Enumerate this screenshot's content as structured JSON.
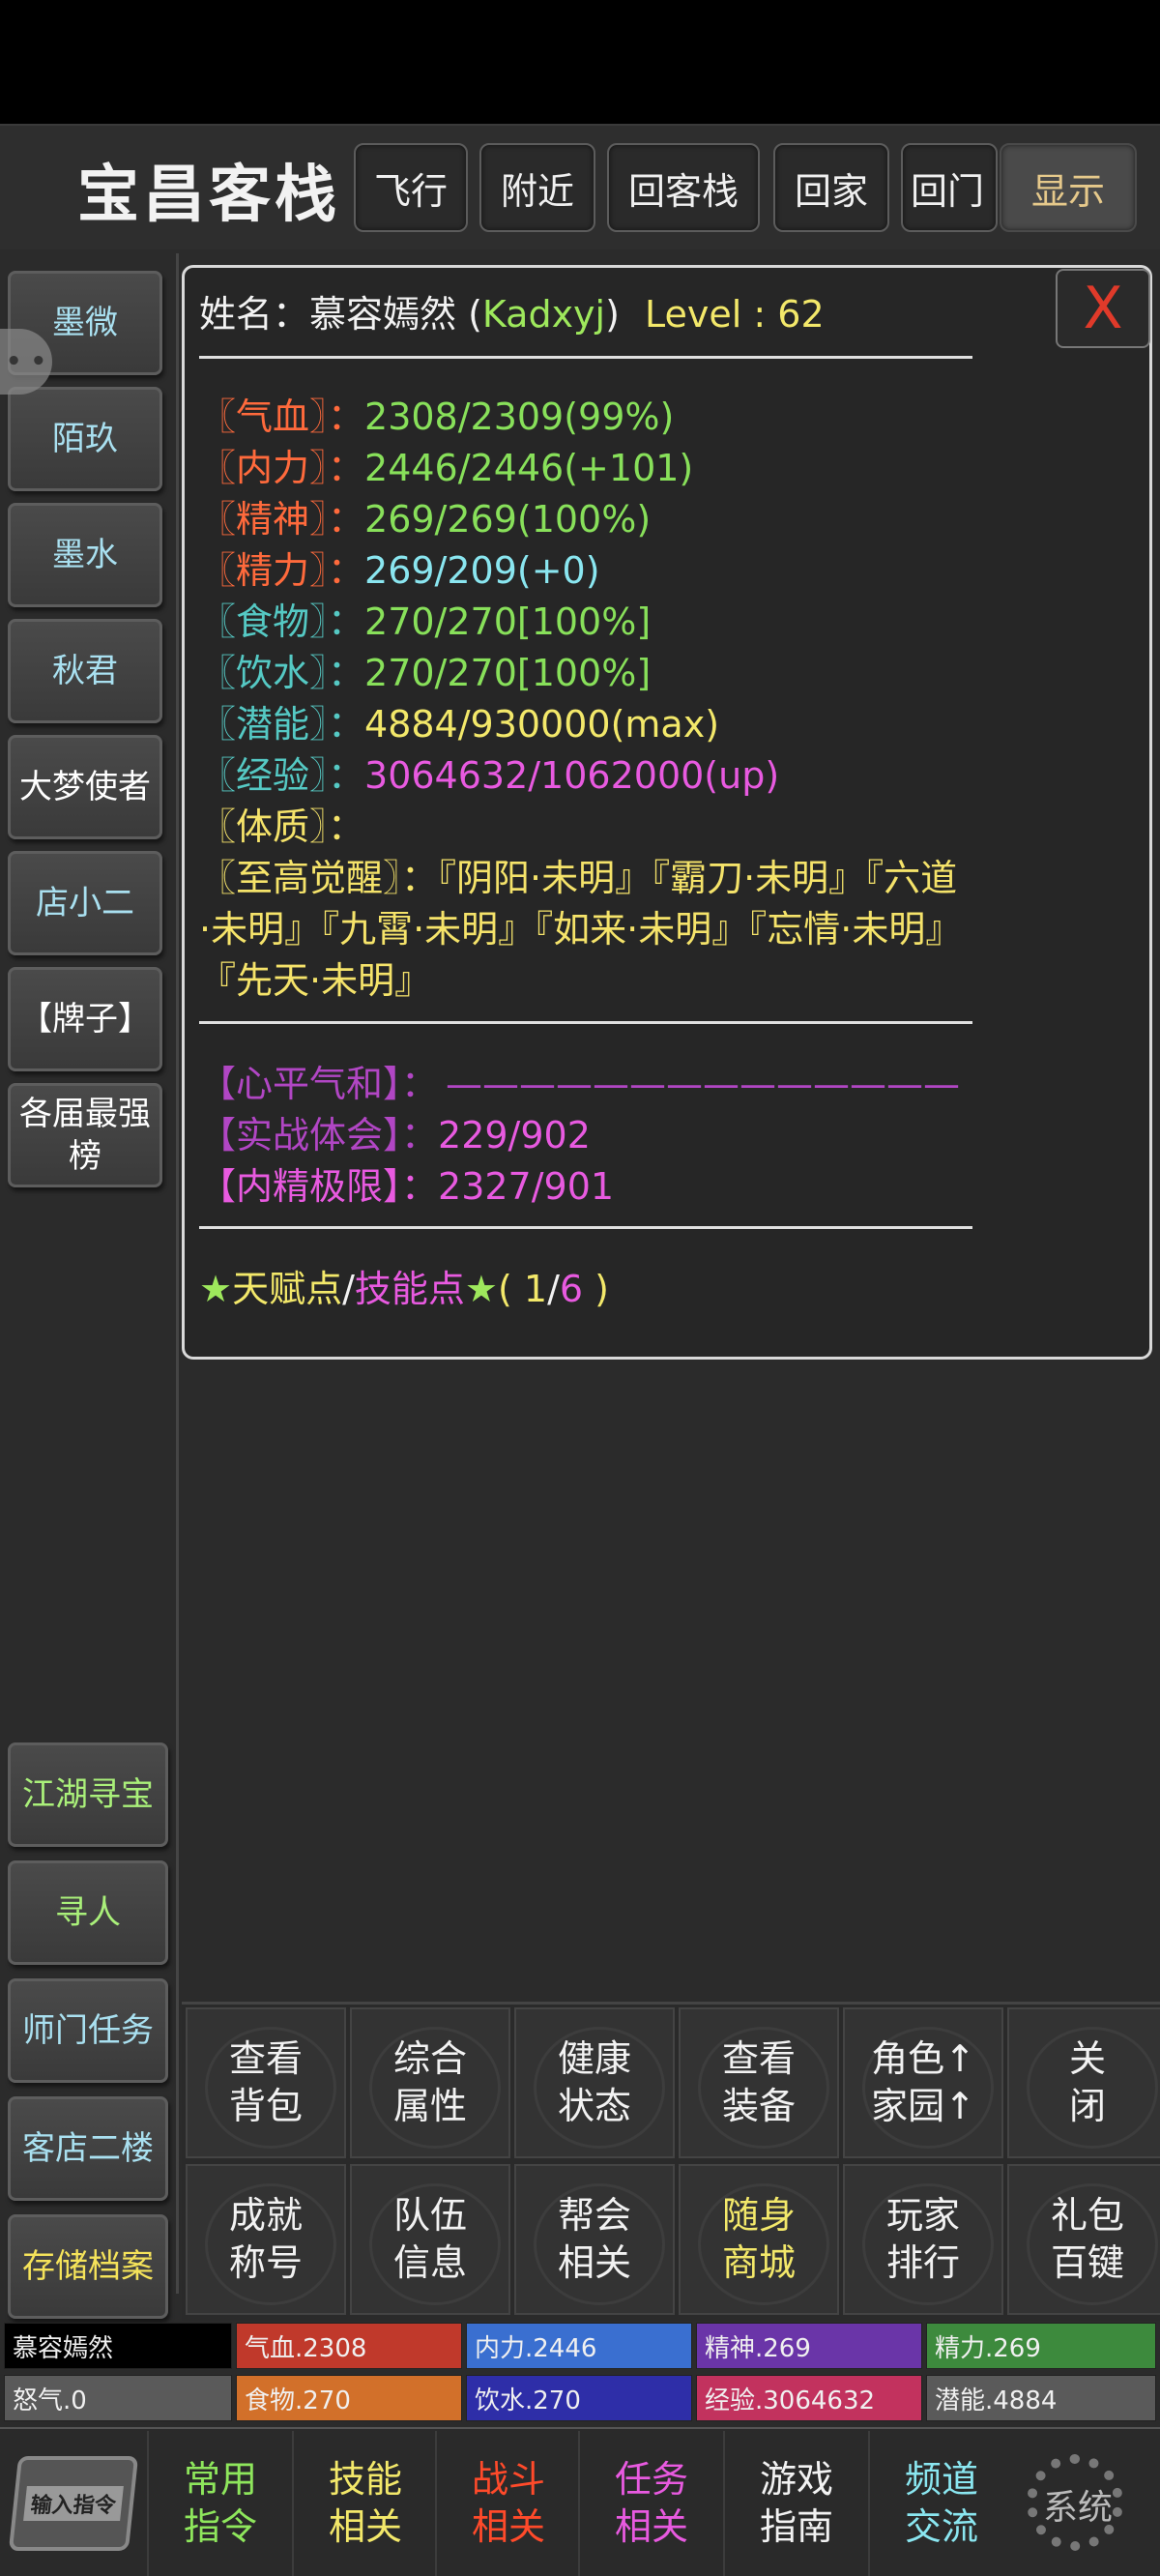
{
  "header": {
    "location": "宝昌客栈",
    "buttons": [
      "飞行",
      "附近",
      "回客栈",
      "回家",
      "回门"
    ],
    "show_label": "显示"
  },
  "chat_bubble_icon": "chat-bubble-icon",
  "sidebar": {
    "top": [
      "墨微",
      "陌玖",
      "墨水",
      "秋君",
      "大梦使者",
      "店小二",
      "【牌子】",
      "各届最强\n榜"
    ],
    "bottom": [
      "江湖寻宝",
      "寻人",
      "师门任务",
      "客店二楼",
      "存储档案"
    ]
  },
  "panel": {
    "close_label": "X",
    "name_label": "姓名：慕容嫣然 (",
    "name_id": "Kadxyj",
    "name_close": ")",
    "level": "Level : 62",
    "divider": "————————————————————————",
    "stats": [
      {
        "label": "〖气血〗：",
        "value": "2308/2309(99%)"
      },
      {
        "label": "〖内力〗：",
        "value": "2446/2446(+101)"
      },
      {
        "label": "〖精神〗：",
        "value": "269/269(100%)"
      },
      {
        "label": "〖精力〗：",
        "value": "269/209(+0)"
      },
      {
        "label": "〖食物〗：",
        "value": "270/270[100%]"
      },
      {
        "label": "〖饮水〗：",
        "value": "270/270[100%]"
      },
      {
        "label": "〖潜能〗：",
        "value": "4884/930000(max)"
      },
      {
        "label": "〖经验〗：",
        "value": "3064632/1062000(up)"
      },
      {
        "label": "〖体质〗：",
        "value": ""
      }
    ],
    "awaken_lines": [
      "〖至高觉醒〗：『阴阳·未明』『霸刀·未明』『六道",
      "·未明』『九霄·未明』『如来·未明』『忘情·未明』",
      "『先天·未明』"
    ],
    "sub_stats": [
      {
        "label": "【心平气和】：",
        "value": "——————————————"
      },
      {
        "label": "【实战体会】：",
        "value": "229/902"
      },
      {
        "label": "【内精极限】：",
        "value": "2327/901"
      }
    ],
    "talent": {
      "star1": "★",
      "talent_label": "天赋点",
      "slash": "/",
      "skill_label": "技能点",
      "star2": "★",
      "open": "( ",
      "talent_val": "1",
      "sep": "/",
      "skill_val": "6",
      "close": " )"
    }
  },
  "grid": [
    [
      "查看\n背包",
      "综合\n属性",
      "健康\n状态",
      "查看\n装备",
      "角色↑\n家园↑",
      "关\n闭"
    ],
    [
      "成就\n称号",
      "队伍\n信息",
      "帮会\n相关",
      "随身\n商城",
      "玩家\n排行",
      "礼包\n百键"
    ]
  ],
  "statbars": {
    "row1": [
      {
        "text": "慕容嫣然",
        "color": "#000000"
      },
      {
        "text": "气血.2308",
        "color": "#c0392b"
      },
      {
        "text": "内力.2446",
        "color": "#3a6fd0"
      },
      {
        "text": "精神.269",
        "color": "#6a35a8"
      },
      {
        "text": "精力.269",
        "color": "#3d8a3d"
      }
    ],
    "row2": [
      {
        "text": "怒气.0",
        "color": "#5a5a5a"
      },
      {
        "text": "食物.270",
        "color": "#d2702a"
      },
      {
        "text": "饮水.270",
        "color": "#2e2ea8"
      },
      {
        "text": "经验.3064632",
        "color": "#c2325e"
      },
      {
        "text": "潜能.4884",
        "color": "#5a5a5a"
      }
    ]
  },
  "bottom_nav": {
    "cmd_label": "输入指令",
    "items": [
      {
        "label": "常用\n指令",
        "color": "green"
      },
      {
        "label": "技能\n相关",
        "color": "yellow"
      },
      {
        "label": "战斗\n相关",
        "color": "red"
      },
      {
        "label": "任务\n相关",
        "color": "magenta"
      },
      {
        "label": "游戏\n指南",
        "color": "white"
      },
      {
        "label": "频道\n交流",
        "color": "cyan"
      }
    ],
    "system_label": "系统"
  }
}
